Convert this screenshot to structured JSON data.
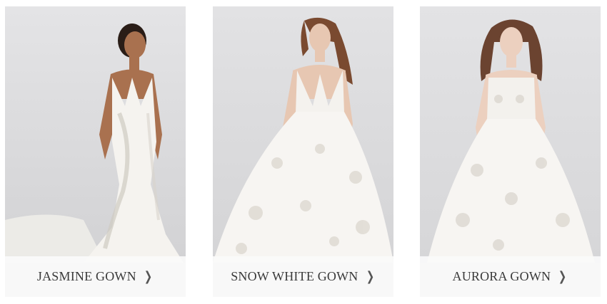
{
  "cards": [
    {
      "label": "JASMINE GOWN",
      "icon": "chevron-right-icon"
    },
    {
      "label": "SNOW WHITE GOWN",
      "icon": "chevron-right-icon"
    },
    {
      "label": "AURORA GOWN",
      "icon": "chevron-right-icon"
    }
  ],
  "colors": {
    "photo_background": "#dcdcdc",
    "label_background": "#fafafa",
    "label_text": "#3a3a3a"
  }
}
